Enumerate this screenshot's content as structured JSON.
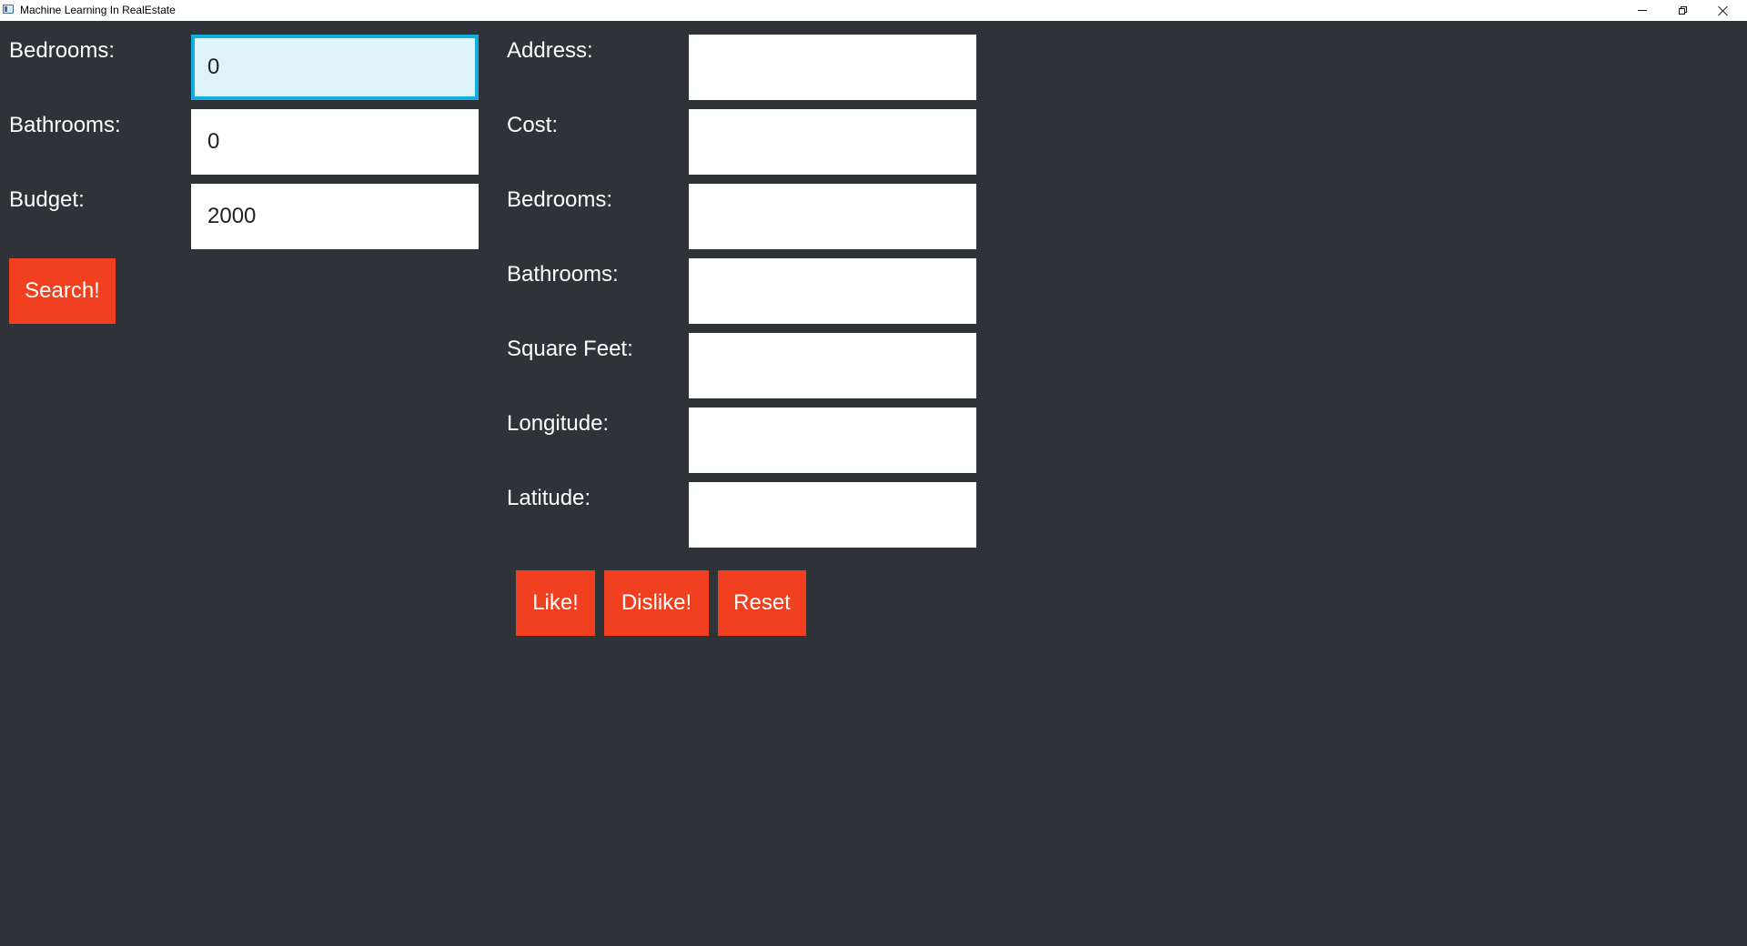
{
  "window": {
    "title": "Machine Learning In RealEstate"
  },
  "search_panel": {
    "bedrooms_label": "Bedrooms:",
    "bedrooms_value": "0",
    "bathrooms_label": "Bathrooms:",
    "bathrooms_value": "0",
    "budget_label": "Budget:",
    "budget_value": "2000",
    "search_button": "Search!"
  },
  "details_panel": {
    "address_label": "Address:",
    "address_value": "",
    "cost_label": "Cost:",
    "cost_value": "",
    "bedrooms_label": "Bedrooms:",
    "bedrooms_value": "",
    "bathrooms_label": "Bathrooms:",
    "bathrooms_value": "",
    "square_feet_label": "Square Feet:",
    "square_feet_value": "",
    "longitude_label": "Longitude:",
    "longitude_value": "",
    "latitude_label": "Latitude:",
    "latitude_value": ""
  },
  "actions": {
    "like_button": "Like!",
    "dislike_button": "Dislike!",
    "reset_button": "Reset"
  },
  "colors": {
    "background": "#2f3338",
    "accent_button": "#f0401f",
    "focus_border": "#12aede",
    "focus_fill": "#dff3fa"
  },
  "icons": {
    "app": "app-window-icon",
    "minimize": "minimize-icon",
    "restore": "restore-icon",
    "close": "close-icon"
  }
}
